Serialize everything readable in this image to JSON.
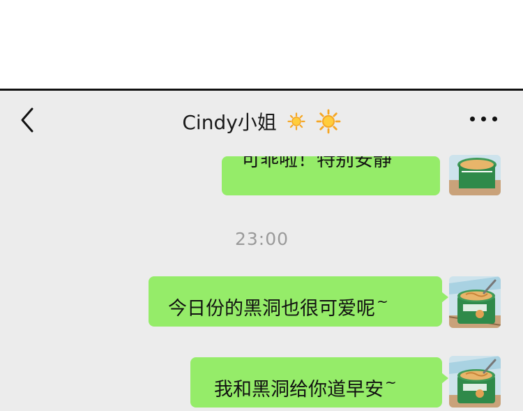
{
  "chat": {
    "title": "Cindy小姐",
    "title_emoji_count": 2,
    "accent_bubble_color": "#95ec69",
    "background_color": "#ececec"
  },
  "header": {
    "back_icon": "chevron-left-icon",
    "more_icon": "more-dots-icon"
  },
  "messages": [
    {
      "text": "可乖啦！特别安静",
      "tilde": ""
    },
    {
      "text": "今日份的黑洞也很可爱呢",
      "tilde": "~"
    },
    {
      "text": "我和黑洞给你道早安",
      "tilde": "~"
    }
  ],
  "timestamp": "23:00"
}
